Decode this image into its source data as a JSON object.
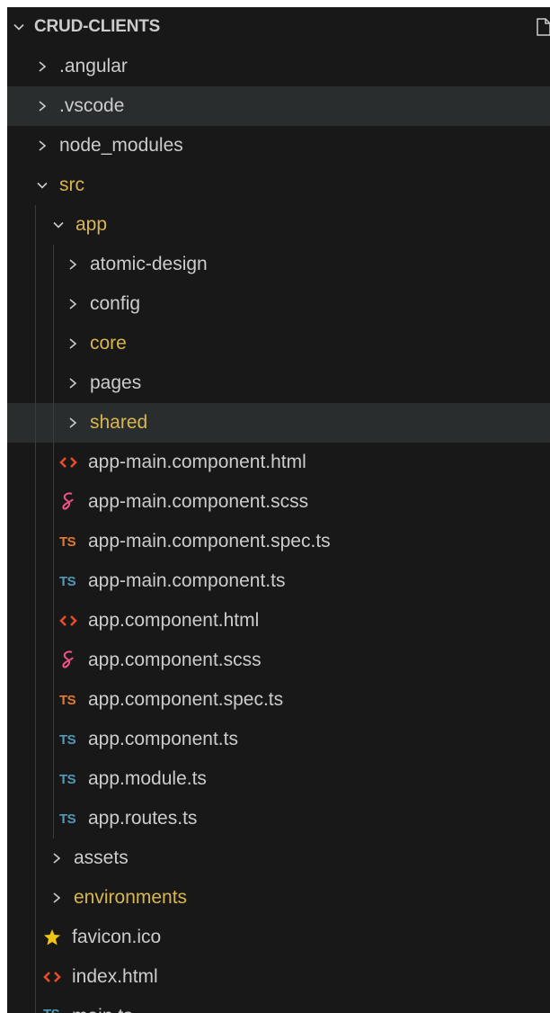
{
  "explorer": {
    "root_label": "CRUD-CLIENTS",
    "colors": {
      "background": "#181818",
      "text": "#cccccc",
      "modified_text": "#d8b64f",
      "ts_blue": "#519aba",
      "ts_orange": "#e37933",
      "html_icon": "#e44d26",
      "scss_icon": "#f55385",
      "star_icon": "#f1c40f",
      "selected_row": "#2a2d2e"
    },
    "items": [
      {
        "label": ".angular",
        "type": "folder",
        "expanded": false
      },
      {
        "label": ".vscode",
        "type": "folder",
        "expanded": false,
        "selected": true
      },
      {
        "label": "node_modules",
        "type": "folder",
        "expanded": false
      },
      {
        "label": "src",
        "type": "folder",
        "expanded": true,
        "modified": true
      },
      {
        "label": "app",
        "type": "folder",
        "expanded": true,
        "modified": true
      },
      {
        "label": "atomic-design",
        "type": "folder",
        "expanded": false
      },
      {
        "label": "config",
        "type": "folder",
        "expanded": false
      },
      {
        "label": "core",
        "type": "folder",
        "expanded": false,
        "modified": true
      },
      {
        "label": "pages",
        "type": "folder",
        "expanded": false
      },
      {
        "label": "shared",
        "type": "folder",
        "expanded": false,
        "modified": true,
        "selected": true
      },
      {
        "label": "app-main.component.html",
        "type": "file",
        "icon": "html-icon"
      },
      {
        "label": "app-main.component.scss",
        "type": "file",
        "icon": "scss-icon"
      },
      {
        "label": "app-main.component.spec.ts",
        "type": "file",
        "icon": "ts-spec-icon",
        "icon_text": "TS"
      },
      {
        "label": "app-main.component.ts",
        "type": "file",
        "icon": "ts-icon",
        "icon_text": "TS"
      },
      {
        "label": "app.component.html",
        "type": "file",
        "icon": "html-icon"
      },
      {
        "label": "app.component.scss",
        "type": "file",
        "icon": "scss-icon"
      },
      {
        "label": "app.component.spec.ts",
        "type": "file",
        "icon": "ts-spec-icon",
        "icon_text": "TS"
      },
      {
        "label": "app.component.ts",
        "type": "file",
        "icon": "ts-icon",
        "icon_text": "TS"
      },
      {
        "label": "app.module.ts",
        "type": "file",
        "icon": "ts-icon",
        "icon_text": "TS"
      },
      {
        "label": "app.routes.ts",
        "type": "file",
        "icon": "ts-icon",
        "icon_text": "TS"
      },
      {
        "label": "assets",
        "type": "folder",
        "expanded": false
      },
      {
        "label": "environments",
        "type": "folder",
        "expanded": false,
        "modified": true
      },
      {
        "label": "favicon.ico",
        "type": "file",
        "icon": "star-icon"
      },
      {
        "label": "index.html",
        "type": "file",
        "icon": "html-icon"
      },
      {
        "label": "main.ts",
        "type": "file",
        "icon": "ts-icon",
        "icon_text": "TS"
      }
    ]
  }
}
